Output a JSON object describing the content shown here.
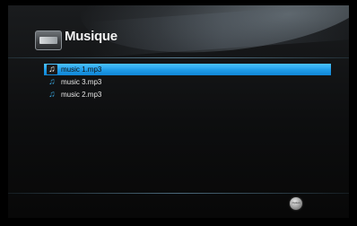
{
  "header": {
    "title": "Musique",
    "icon": "music-device-icon"
  },
  "file_list": {
    "items": [
      {
        "name": "music 1.mp3",
        "icon": "music-note-icon",
        "selected": true
      },
      {
        "name": "music 3.mp3",
        "icon": "music-note-icon",
        "selected": false
      },
      {
        "name": "music 2.mp3",
        "icon": "music-note-icon",
        "selected": false
      }
    ]
  },
  "footer": {
    "option_label": "Option",
    "option_icon": "option-button-icon"
  },
  "colors": {
    "selection": "#1e9be6",
    "note_icon": "#39a7e0",
    "background": "#0d0e0f"
  }
}
